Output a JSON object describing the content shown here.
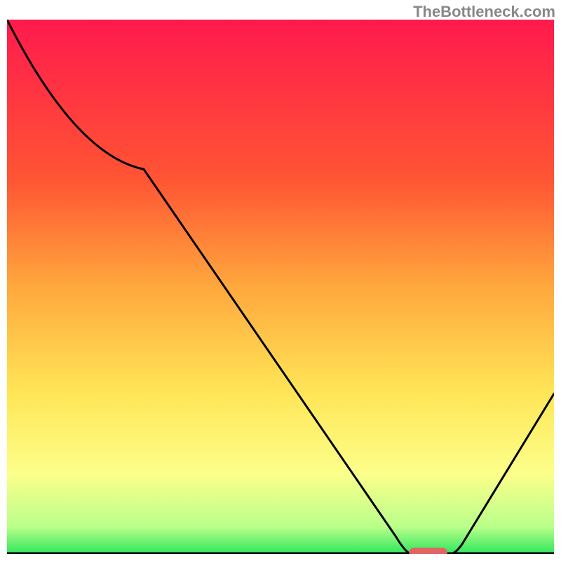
{
  "watermark": "TheBottleneck.com",
  "chart_data": {
    "type": "line",
    "title": "",
    "xlabel": "",
    "ylabel": "",
    "xlim": [
      0,
      100
    ],
    "ylim": [
      0,
      100
    ],
    "series": [
      {
        "name": "curve",
        "x": [
          0,
          25,
          73,
          82,
          100
        ],
        "y": [
          100,
          72,
          0,
          0,
          30
        ]
      }
    ],
    "marker": {
      "x_center": 77,
      "y": 0,
      "width_x": 7,
      "color": "#e06666"
    },
    "gradient_stops": [
      {
        "offset": 0,
        "color": "#ff1a4d"
      },
      {
        "offset": 30,
        "color": "#ff5533"
      },
      {
        "offset": 50,
        "color": "#ffa83d"
      },
      {
        "offset": 70,
        "color": "#ffe657"
      },
      {
        "offset": 85,
        "color": "#fcff8a"
      },
      {
        "offset": 95,
        "color": "#b8ff8a"
      },
      {
        "offset": 100,
        "color": "#2ee65c"
      }
    ]
  }
}
